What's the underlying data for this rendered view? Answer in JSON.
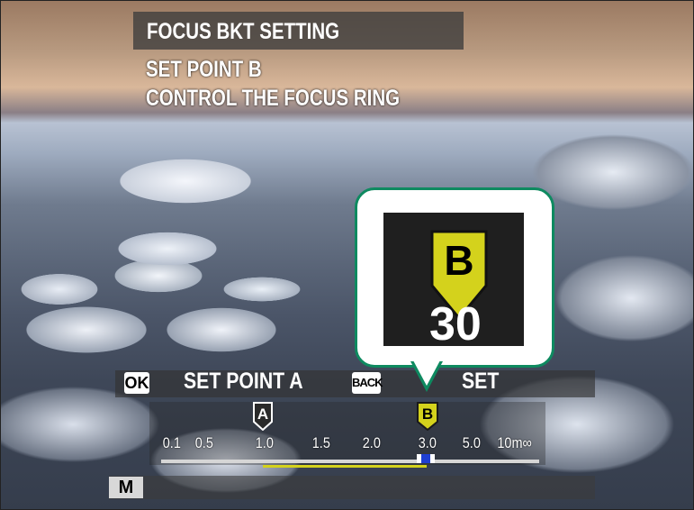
{
  "header": {
    "title": "FOCUS BKT SETTING",
    "instruction_line1": "SET POINT B",
    "instruction_line2": "CONTROL THE FOCUS RING"
  },
  "actions": {
    "ok_icon": "OK",
    "ok_label": "SET POINT A",
    "back_icon": "BACK",
    "back_label": "SET"
  },
  "scale": {
    "ticks": [
      "0.1",
      "0.5",
      "1.0",
      "1.5",
      "2.0",
      "3.0",
      "5.0",
      "10m∞"
    ],
    "point_a": {
      "label": "A",
      "value": "1.0"
    },
    "point_b": {
      "label": "B",
      "value": "3.0"
    }
  },
  "magnifier": {
    "marker_label": "B",
    "value_text": "30"
  },
  "mode": {
    "focus_mode": "M"
  },
  "colors": {
    "accent_green": "#0e8a60",
    "marker_yellow": "#d4d21c",
    "current_blue": "#1f3fd2"
  }
}
